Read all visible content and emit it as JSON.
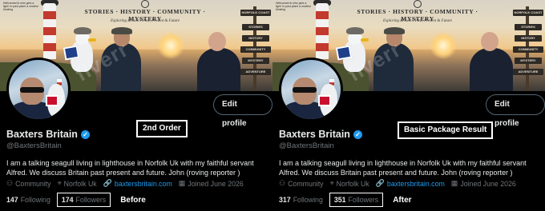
{
  "banner": {
    "nav": "STORIES · HISTORY · COMMUNITY · MYSTERY",
    "tagline": "Exploring Britain's Past, Present & Future",
    "corner_note": "Welcomed to who gets a light: to past place a modest thinking",
    "signs": [
      "NORFOLK COAST",
      "STORIES",
      "HISTORY",
      "COMMUNITY",
      "MYSTERY",
      "ADVENTURE"
    ],
    "watermark": "fiverr"
  },
  "panels": [
    {
      "id": "before",
      "edit_label": "Edit profile",
      "name": "Baxters Britain",
      "handle": "@BaxtersBritain",
      "bio": "I am a talking seagull living in lighthouse in Norfolk Uk with my faithful servant Alfred. We discuss Britain past present and future. John (roving reporter )",
      "community": "Community",
      "location": "Norfolk Uk",
      "website": "baxtersbritain.com",
      "joined": "Joined June 2026",
      "following_count": "147",
      "following_label": "Following",
      "followers_count": "174",
      "followers_label": "Followers",
      "annotation_box": "2nd Order",
      "annotation_text": "Before"
    },
    {
      "id": "after",
      "edit_label": "Edit profile",
      "name": "Baxters Britain",
      "handle": "@BaxtersBritain",
      "bio": "I am a talking seagull living in lighthouse in Norfolk Uk with my faithful servant Alfred. We discuss Britain past present and future. John (roving reporter )",
      "community": "Community",
      "location": "Norfolk Uk",
      "website": "baxtersbritain.com",
      "joined": "Joined June 2026",
      "following_count": "317",
      "following_label": "Following",
      "followers_count": "351",
      "followers_label": "Followers",
      "annotation_box": "Basic Package Result",
      "annotation_text": "After"
    }
  ],
  "colors": {
    "accent": "#1d9bf0",
    "background": "#000000",
    "muted": "#71767b",
    "text": "#e7e9ea"
  }
}
